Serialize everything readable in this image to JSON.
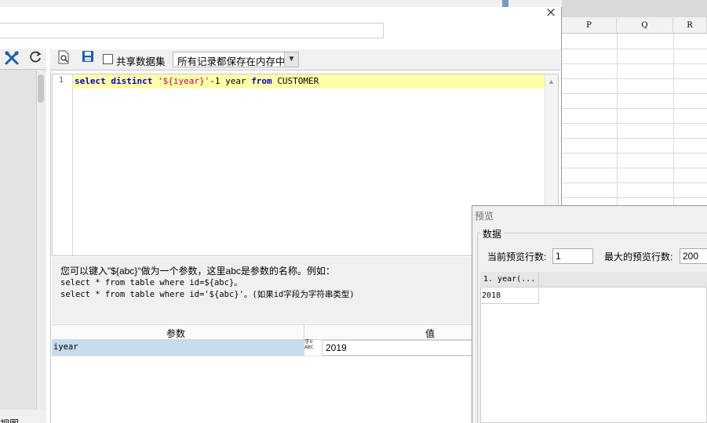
{
  "spreadsheet": {
    "columns": [
      "P",
      "Q",
      "R"
    ]
  },
  "dialog": {
    "close_glyph": "×",
    "name_field_value": ""
  },
  "left_panel": {
    "bottom_text": "视图",
    "icons": [
      "tools-icon",
      "refresh-icon"
    ]
  },
  "toolbar": {
    "preview_icon": "preview-icon",
    "save_icon": "save-icon",
    "share_checkbox_label": "共享数据集",
    "share_checked": false,
    "storage_select_value": "所有记录都保存在内存中"
  },
  "editor": {
    "line_number": "1",
    "sql": {
      "kw1": "select distinct",
      "str": "'${iyear}'",
      "plain1": "-1 year",
      "kw2": "from",
      "plain2": "CUSTOMER"
    }
  },
  "hint": {
    "line1": "您可以键入\"${abc}\"做为一个参数，这里abc是参数的名称。例如：",
    "line2": "select * from table where id=${abc}。",
    "line3": "select * from table where id='${abc}'。(如果id字段为字符串类型)"
  },
  "params_table": {
    "headers": {
      "param": "参数",
      "value": "值"
    },
    "rows": [
      {
        "name": "iyear",
        "type_top": "字U",
        "type_bottom": "ABC",
        "value": "2019"
      }
    ]
  },
  "preview": {
    "title": "预览",
    "group_label": "数据",
    "current_rows_label": "当前预览行数:",
    "current_rows_value": "1",
    "max_rows_label": "最大的预览行数:",
    "max_rows_value": "200",
    "grid_header": "1. year(...",
    "grid_rows": [
      "2018"
    ]
  }
}
